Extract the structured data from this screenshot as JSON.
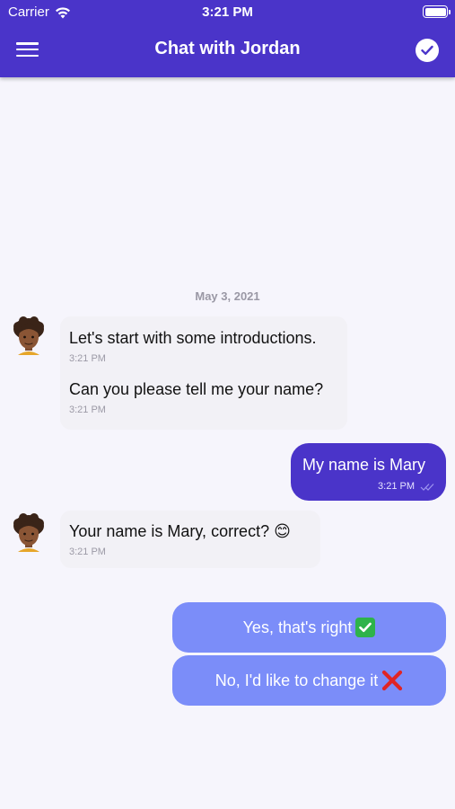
{
  "status_bar": {
    "carrier": "Carrier",
    "time": "3:21 PM"
  },
  "header": {
    "title": "Chat with Jordan"
  },
  "chat": {
    "date": "May 3, 2021",
    "messages_in_1": [
      {
        "text": "Let's start with some introductions.",
        "time": "3:21 PM"
      },
      {
        "text": "Can you please tell me your name?",
        "time": "3:21 PM"
      }
    ],
    "message_out": {
      "text": "My name is Mary",
      "time": "3:21 PM"
    },
    "message_in_2": {
      "text": "Your name is Mary, correct? 😊",
      "time": "3:21 PM"
    }
  },
  "replies": [
    {
      "label": "Yes, that's right"
    },
    {
      "label": "No, I'd like to change it"
    }
  ],
  "icons": {
    "menu": "menu-icon",
    "confirm": "check-circle-icon",
    "wifi": "wifi-icon",
    "battery": "battery-icon",
    "avatar": "avatar",
    "read": "double-check-icon",
    "yes": "check-mark-button-icon",
    "no": "cross-mark-icon"
  },
  "colors": {
    "header": "#4a34c9",
    "background": "#f6f5fc",
    "bubble_in": "#f2f1f6",
    "bubble_out": "#4a34c9",
    "reply": "#7b8df9"
  }
}
